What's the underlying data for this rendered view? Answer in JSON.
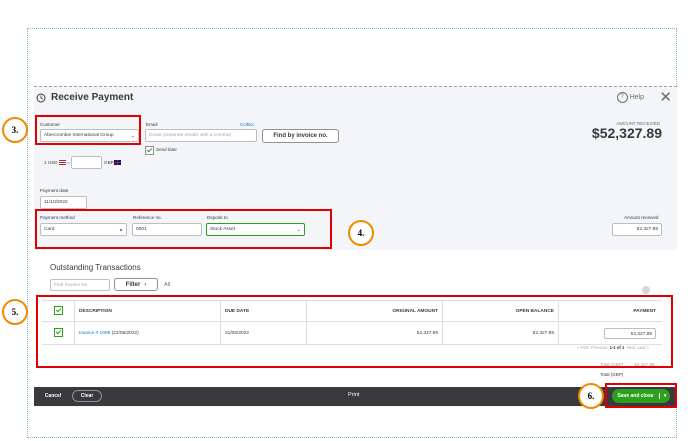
{
  "header": {
    "title": "Receive Payment",
    "help_label": "Help"
  },
  "customer": {
    "label": "Customer",
    "value": "Abercrombie International Group"
  },
  "email": {
    "label": "Email",
    "placeholder": "Email (Separate emails with a comma)",
    "ccbcc": "Cc/Bcc",
    "send_later": "Send later"
  },
  "find_button": "Find by invoice no.",
  "currency": {
    "base": "1 USD",
    "equals": "=",
    "foreign": "GBP"
  },
  "amount_received_header": {
    "label": "AMOUNT RECEIVED",
    "value": "$52,327.89"
  },
  "payment_date": {
    "label": "Payment date",
    "value": "11/10/2022"
  },
  "payment_method": {
    "label": "Payment method",
    "value": "Card"
  },
  "reference": {
    "label": "Reference no.",
    "value": "0001"
  },
  "deposit_to": {
    "label": "Deposit to",
    "value": "Stock Asset"
  },
  "amount_received": {
    "label": "Amount received",
    "value": "52,327.89"
  },
  "outstanding": {
    "title": "Outstanding Transactions",
    "find_placeholder": "Find Invoice No.",
    "filter_label": "Filter",
    "all_label": "All",
    "columns": [
      "DESCRIPTION",
      "DUE DATE",
      "ORIGINAL AMOUNT",
      "OPEN BALANCE",
      "PAYMENT"
    ],
    "rows": [
      {
        "invoice_link": "Invoice # 1009",
        "invoice_date": "(22/05/2022)",
        "due": "21/06/2022",
        "original": "52,327.89",
        "open": "52,327.89",
        "payment": "52,327.89"
      }
    ],
    "pager": {
      "first": "« First",
      "previous": "Previous",
      "range": "1-1 of 1",
      "next": "Next",
      "last": "Last »"
    }
  },
  "totals": {
    "partial_label": "Total (GBP)",
    "partial_value": "52,327.89",
    "label": "Total (GBP)"
  },
  "footer": {
    "cancel": "Cancel",
    "clear": "Clear",
    "print": "Print",
    "save": "Save and close"
  },
  "annotations": {
    "a3": "3.",
    "a4": "4.",
    "a5": "5.",
    "a6": "6."
  },
  "colors": {
    "accent_green": "#2ca01c",
    "highlight_red": "#e00000",
    "annotation_orange": "#f08a00",
    "footer_dark": "#393a3d"
  }
}
